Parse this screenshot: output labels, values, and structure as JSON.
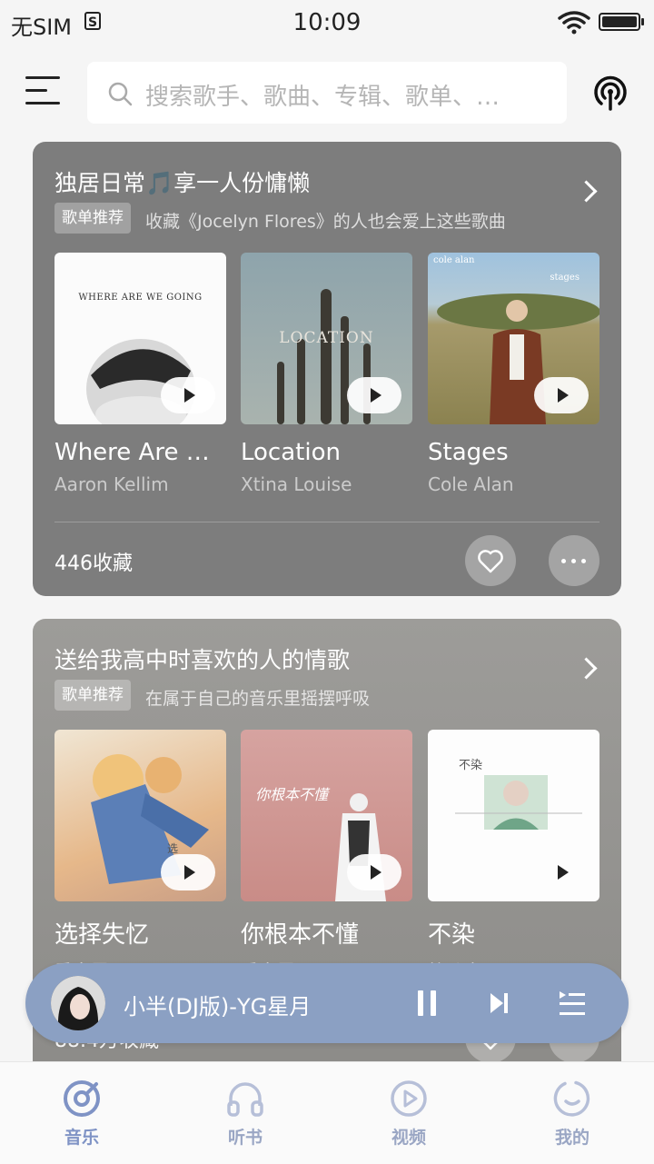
{
  "status_bar": {
    "carrier": "无SIM",
    "sim_badge": "S",
    "time": "10:09"
  },
  "search": {
    "placeholder": "搜索歌手、歌曲、专辑、歌单、…"
  },
  "cards": [
    {
      "title": "独居日常🎵享一人份慵懒",
      "tag": "歌单推荐",
      "subtitle": "收藏《Jocelyn Flores》的人也会爱上这些歌曲",
      "albums": [
        {
          "name": "Where Are We Going",
          "artist": "Aaron Kellim",
          "cover_text": "WHERE ARE WE GOING"
        },
        {
          "name": "Location",
          "artist": "Xtina Louise",
          "cover_text": "LOCATION"
        },
        {
          "name": "Stages",
          "artist": "Cole Alan",
          "cover_text": "cole alan",
          "cover_text_2": "stages"
        }
      ],
      "collect_count": "446收藏"
    },
    {
      "title": "送给我高中时喜欢的人的情歌",
      "tag": "歌单推荐",
      "subtitle": "在属于自己的音乐里摇摆呼吸",
      "albums": [
        {
          "name": "选择失忆",
          "artist": "季彦霖",
          "cover_text": "选"
        },
        {
          "name": "你根本不懂",
          "artist": "季彦霖",
          "cover_text": "你根本不懂"
        },
        {
          "name": "不染",
          "artist": "简弘亦",
          "cover_text": "不染"
        }
      ],
      "collect_count": "88.4万收藏"
    }
  ],
  "player": {
    "song": "小半(DJ版)-YG星月"
  },
  "tabs": [
    {
      "label": "音乐",
      "active": true
    },
    {
      "label": "听书",
      "active": false
    },
    {
      "label": "视频",
      "active": false
    },
    {
      "label": "我的",
      "active": false
    }
  ],
  "colors": {
    "accent": "#7f93c5",
    "player_bg": "#8ba0c3"
  }
}
